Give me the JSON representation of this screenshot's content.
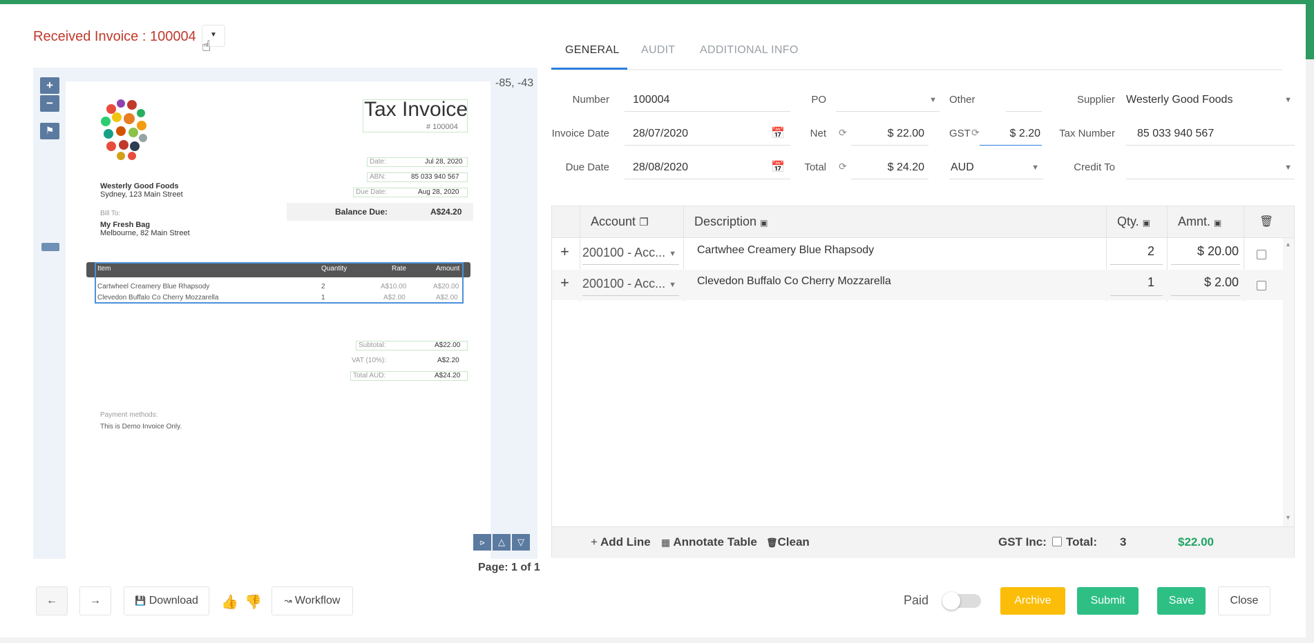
{
  "header": {
    "title": "Received Invoice : 100004"
  },
  "viewer": {
    "coords": "-85, -43",
    "page_info": "Page: 1 of 1",
    "tools": {
      "zoom_in": "+",
      "zoom_out": "−"
    },
    "preview": {
      "title": "Tax Invoice",
      "number": "# 100004",
      "date_label": "Date:",
      "date_value": "Jul 28, 2020",
      "abn_label": "ABN:",
      "abn_value": "85 033 940 567",
      "due_label": "Due Date:",
      "due_value": "Aug 28, 2020",
      "balance_label": "Balance Due:",
      "balance_value": "A$24.20",
      "supplier_name": "Westerly Good Foods",
      "supplier_addr": "Sydney, 123 Main Street",
      "billto_label": "Bill To:",
      "billto_name": "My Fresh Bag",
      "billto_addr": "Melbourne, 82 Main Street",
      "cols": [
        "Item",
        "Quantity",
        "Rate",
        "Amount"
      ],
      "items": [
        {
          "name": "Cartwheel Creamery Blue Rhapsody",
          "qty": "2",
          "rate": "A$10.00",
          "amount": "A$20.00"
        },
        {
          "name": "Clevedon Buffalo Co Cherry Mozzarella",
          "qty": "1",
          "rate": "A$2.00",
          "amount": "A$2.00"
        }
      ],
      "subtotal_label": "Subtotal:",
      "subtotal_value": "A$22.00",
      "vat_label": "VAT (10%):",
      "vat_value": "A$2.20",
      "total_label": "Total AUD:",
      "total_value": "A$24.20",
      "payment_label": "Payment methods:",
      "payment_note": "This is Demo Invoice Only."
    }
  },
  "tabs": [
    "GENERAL",
    "AUDIT",
    "ADDITIONAL INFO"
  ],
  "form": {
    "number_label": "Number",
    "number_value": "100004",
    "po_label": "PO",
    "po_value": "",
    "other_label": "Other",
    "other_value": "",
    "supplier_label": "Supplier",
    "supplier_value": "Westerly Good Foods",
    "invoice_date_label": "Invoice Date",
    "invoice_date_value": "28/07/2020",
    "net_label": "Net",
    "net_value": "$ 22.00",
    "gst_label": "GST",
    "gst_value": "$ 2.20",
    "tax_number_label": "Tax Number",
    "tax_number_value": "85 033 940 567",
    "due_date_label": "Due Date",
    "due_date_value": "28/08/2020",
    "total_label": "Total",
    "total_value": "$ 24.20",
    "currency_value": "AUD",
    "credit_to_label": "Credit To",
    "credit_to_value": ""
  },
  "grid": {
    "headers": {
      "account": "Account",
      "description": "Description",
      "qty": "Qty.",
      "amount": "Amnt."
    },
    "rows": [
      {
        "account": "200100 - Acc...",
        "description": "Cartwhee Creamery Blue Rhapsody",
        "qty": "2",
        "amount": "$ 20.00"
      },
      {
        "account": "200100 - Acc...",
        "description": "Clevedon Buffalo Co Cherry Mozzarella",
        "qty": "1",
        "amount": "$ 2.00"
      }
    ],
    "footer": {
      "add_line": "Add Line",
      "annotate_table": "Annotate Table",
      "clean": "Clean",
      "gst_inc_label": "GST Inc:",
      "total_label": "Total:",
      "total_count": "3",
      "total_amount": "$22.00"
    }
  },
  "bottom": {
    "download": "Download",
    "workflow": "Workflow",
    "paid_label": "Paid",
    "archive": "Archive",
    "submit": "Submit",
    "save": "Save",
    "close": "Close"
  },
  "colors": {
    "accent_green": "#2ebf85",
    "archive_yellow": "#fbbd08",
    "title_red": "#c0392b",
    "total_green": "#21a366"
  }
}
